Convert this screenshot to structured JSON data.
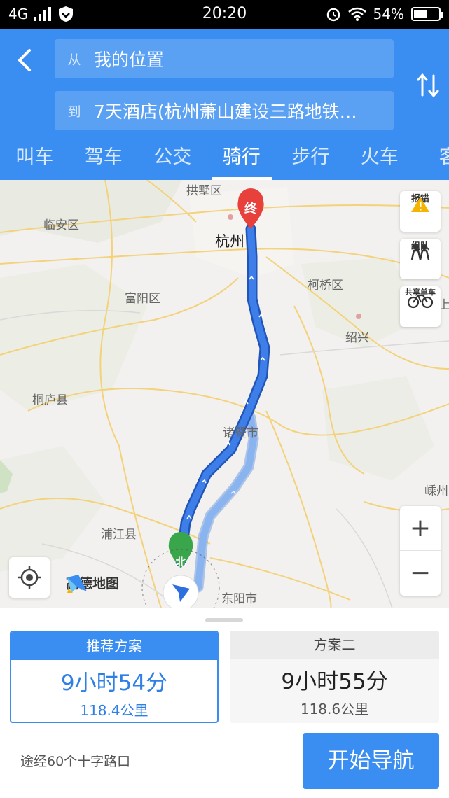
{
  "status_bar": {
    "network": "4G",
    "time": "20:20",
    "battery": "54%",
    "battery_level": 0.54
  },
  "header": {
    "from_prefix": "从",
    "from_value": "我的位置",
    "to_prefix": "到",
    "to_value": "7天酒店(杭州萧山建设三路地铁…",
    "tabs": [
      {
        "label": "叫车",
        "active": false
      },
      {
        "label": "驾车",
        "active": false
      },
      {
        "label": "公交",
        "active": false
      },
      {
        "label": "骑行",
        "active": true
      },
      {
        "label": "步行",
        "active": false
      },
      {
        "label": "火车",
        "active": false
      },
      {
        "label": "客",
        "active": false
      }
    ]
  },
  "map": {
    "labels": {
      "gongshu": "拱墅区",
      "linan": "临安区",
      "hangzhou": "杭州",
      "keqiao": "柯桥区",
      "fuyang": "富阳区",
      "shaoxing": "绍兴",
      "tonglu": "桐庐县",
      "zhuji": "诸暨市",
      "shengzhou": "嵊州",
      "pujiang": "浦江县",
      "dongyang": "东阳市",
      "edge_shang": "上"
    },
    "end_marker": "终",
    "start_marker": "北",
    "side_buttons": {
      "report": "报错",
      "team": "组队",
      "bike": "共享单车"
    },
    "zoom_in": "+",
    "zoom_out": "−",
    "logo_text": "高德地图"
  },
  "plans": [
    {
      "title": "推荐方案",
      "time": "9小时54分",
      "distance": "118.4公里",
      "selected": true
    },
    {
      "title": "方案二",
      "time": "9小时55分",
      "distance": "118.6公里",
      "selected": false
    }
  ],
  "via_text": "途经60个十字路口",
  "start_button": "开始导航",
  "colors": {
    "primary": "#3b8ef1",
    "route": "#3d7ee8",
    "route_alt": "#8ab4f0",
    "end_marker": "#e8413c",
    "start_marker": "#3aa64b"
  }
}
